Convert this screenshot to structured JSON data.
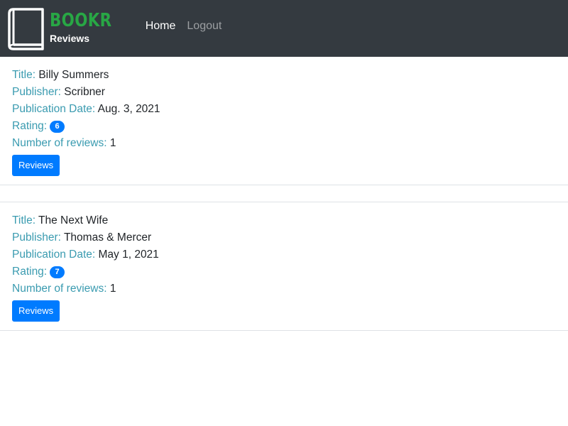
{
  "nav": {
    "brand_title": "BOOKR",
    "brand_subtitle": "Reviews",
    "links": [
      {
        "label": "Home"
      },
      {
        "label": "Logout"
      }
    ]
  },
  "labels": {
    "title": "Title:",
    "publisher": "Publisher:",
    "publication_date": "Publication Date:",
    "rating": "Rating:",
    "num_reviews": "Number of reviews:",
    "reviews_button": "Reviews"
  },
  "books": [
    {
      "title": "Billy Summers",
      "publisher": "Scribner",
      "publication_date": "Aug. 3, 2021",
      "rating": "6",
      "num_reviews": "1"
    },
    {
      "title": "The Next Wife",
      "publisher": "Thomas & Mercer",
      "publication_date": "May 1, 2021",
      "rating": "7",
      "num_reviews": "1"
    }
  ],
  "colors": {
    "navbar_bg": "#343a40",
    "brand_green": "#28a745",
    "label_teal": "#3a9bb0",
    "primary_blue": "#007bff"
  }
}
